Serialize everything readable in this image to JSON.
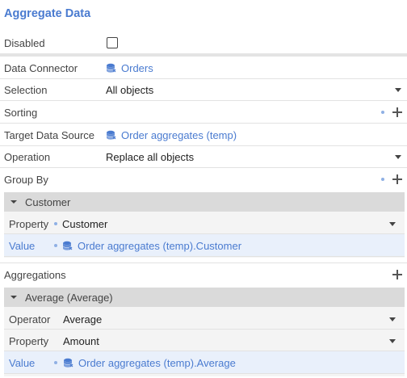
{
  "title": "Aggregate Data",
  "disabled": {
    "label": "Disabled",
    "checked": false
  },
  "data_connector": {
    "label": "Data Connector",
    "value": "Orders"
  },
  "selection": {
    "label": "Selection",
    "value": "All objects"
  },
  "sorting": {
    "label": "Sorting"
  },
  "target_data_source": {
    "label": "Target Data Source",
    "value": "Order aggregates (temp)"
  },
  "operation": {
    "label": "Operation",
    "value": "Replace all objects"
  },
  "group_by": {
    "label": "Group By",
    "items": [
      {
        "title": "Customer",
        "property_label": "Property",
        "property_value": "Customer",
        "value_label": "Value",
        "value": "Order aggregates (temp).Customer"
      }
    ]
  },
  "aggregations": {
    "label": "Aggregations",
    "items": [
      {
        "title": "Average (Average)",
        "operator_label": "Operator",
        "operator_value": "Average",
        "property_label": "Property",
        "property_value": "Amount",
        "value_label": "Value",
        "value": "Order aggregates (temp).Average"
      }
    ]
  },
  "colors": {
    "accent": "#4a7bd0",
    "group_header": "#dadada",
    "value_row": "#e9f0fb"
  }
}
